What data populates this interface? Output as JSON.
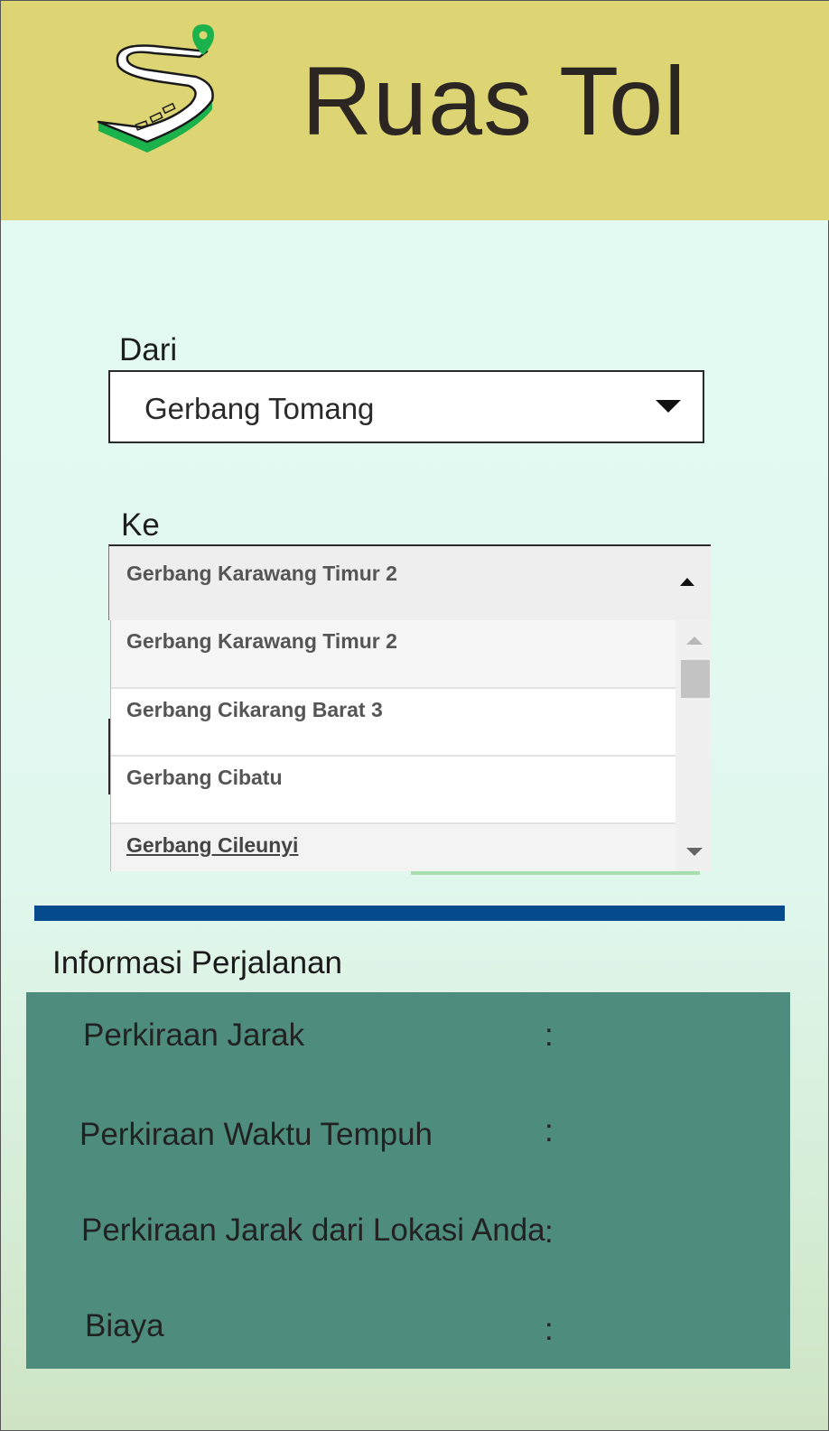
{
  "header": {
    "title": "Ruas Tol",
    "logo_icon": "winding-road-pin-icon",
    "background": "#ddd574"
  },
  "form": {
    "dari_label": "Dari",
    "dari_value": "Gerbang Tomang",
    "ke_label": "Ke",
    "ke_value": "Gerbang Karawang Timur 2",
    "ke_options": [
      "Gerbang Karawang Timur 2",
      "Gerbang Cikarang Barat 3",
      "Gerbang Cibatu",
      "Gerbang Cileunyi"
    ]
  },
  "info": {
    "title": "Informasi Perjalanan",
    "panel_color": "#4e8c7e",
    "rows": [
      {
        "label": "Perkiraan Jarak",
        "colon": ":"
      },
      {
        "label": "Perkiraan Waktu Tempuh",
        "colon": ":"
      },
      {
        "label": "Perkiraan Jarak dari Lokasi Anda",
        "colon": ":"
      },
      {
        "label": "Biaya",
        "colon": ":"
      }
    ]
  },
  "colors": {
    "divider": "#054a8c",
    "accent_green": "#1bb24b"
  }
}
